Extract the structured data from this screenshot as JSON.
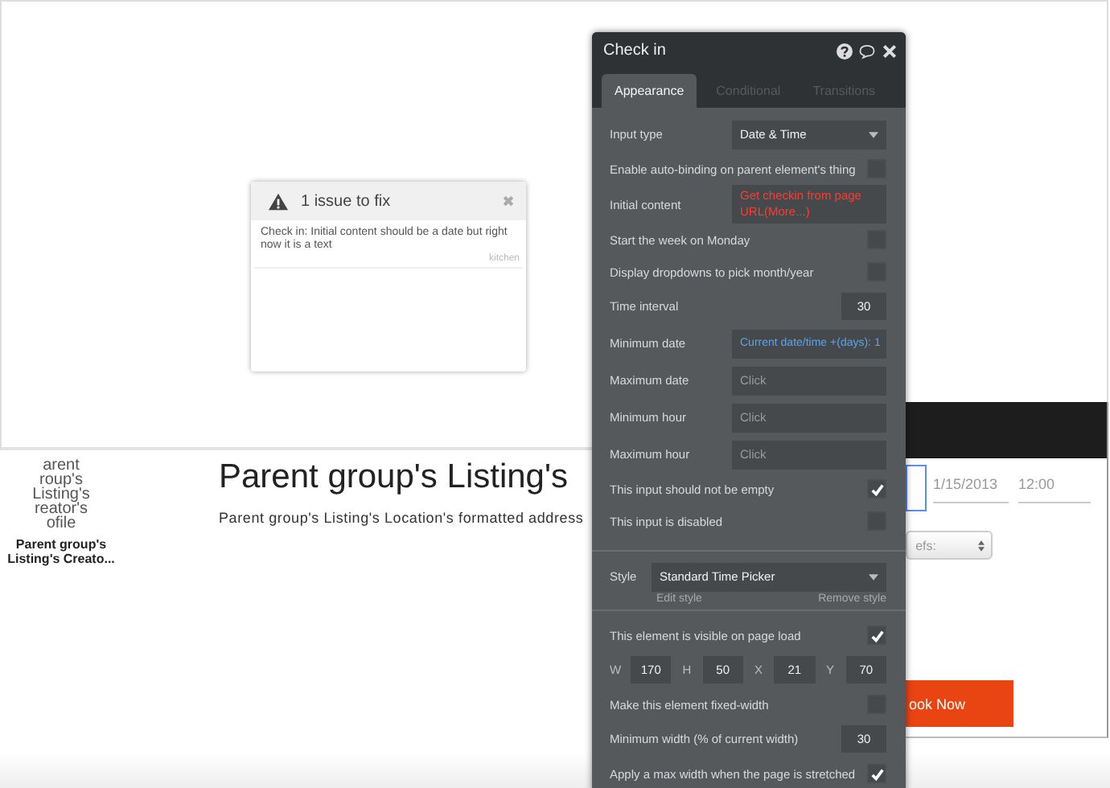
{
  "page": {
    "profile_alt_lines": [
      "arent",
      "roup's",
      "Listing's",
      "reator's",
      "ofile"
    ],
    "profile_name": "Parent group's Listing's Creato...",
    "heading": "Parent group's Listing's",
    "address": "Parent group's Listing's Location's formatted address"
  },
  "booking": {
    "date": "1/15/2013",
    "time": "12:00",
    "dropdown": "efs:",
    "button": "ook Now"
  },
  "issue_popup": {
    "title": "1 issue to fix",
    "message": "Check in: Initial content should be a date but right now it is a text",
    "source": "kitchen"
  },
  "panel": {
    "title": "Check in",
    "tabs": [
      {
        "label": "Appearance",
        "selected": true
      },
      {
        "label": "Conditional",
        "selected": false
      },
      {
        "label": "Transitions",
        "selected": false
      }
    ],
    "rows": [
      {
        "kind": "dropdown",
        "label": "Input type",
        "value": "Date & Time"
      },
      {
        "kind": "checkbox",
        "label": "Enable auto-binding on parent element's thing",
        "checked": false
      },
      {
        "kind": "field",
        "label": "Initial content",
        "value": "Get checkin from page URL(More...)",
        "invalid": true
      },
      {
        "kind": "checkbox",
        "label": "Start the week on Monday",
        "checked": false
      },
      {
        "kind": "checkbox",
        "label": "Display dropdowns to pick month/year",
        "checked": false
      },
      {
        "kind": "number",
        "label": "Time interval",
        "value": "30"
      },
      {
        "kind": "field",
        "label": "Minimum date",
        "value": "Current date/time +(days): 1",
        "dynamic": true
      },
      {
        "kind": "field",
        "label": "Maximum date",
        "placeholder": "Click"
      },
      {
        "kind": "field",
        "label": "Minimum hour",
        "placeholder": "Click"
      },
      {
        "kind": "field",
        "label": "Maximum hour",
        "placeholder": "Click"
      },
      {
        "kind": "checkbox",
        "label": "This input should not be empty",
        "checked": true
      },
      {
        "kind": "checkbox",
        "label": "This input is disabled",
        "checked": false
      }
    ],
    "style": {
      "label": "Style",
      "value": "Standard Time Picker",
      "edit": "Edit style",
      "remove": "Remove style"
    },
    "layout_rows": [
      {
        "kind": "checkbox",
        "label": "This element is visible on page load",
        "checked": true
      },
      {
        "kind": "dims",
        "items": [
          {
            "label": "W",
            "value": "170"
          },
          {
            "label": "H",
            "value": "50"
          },
          {
            "label": "X",
            "value": "21"
          },
          {
            "label": "Y",
            "value": "70"
          }
        ]
      },
      {
        "kind": "checkbox",
        "label": "Make this element fixed-width",
        "checked": false
      },
      {
        "kind": "number",
        "label": "Minimum width (% of current width)",
        "value": "30"
      },
      {
        "kind": "checkbox",
        "label": "Apply a max width when the page is stretched",
        "checked": true
      }
    ]
  }
}
